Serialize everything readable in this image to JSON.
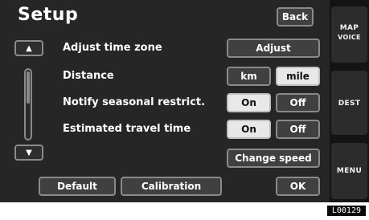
{
  "title": "Setup",
  "back_label": "Back",
  "rows": [
    {
      "label": "Adjust time zone",
      "button": "Adjust"
    },
    {
      "label": "Distance",
      "options": [
        "km",
        "mile"
      ],
      "selected": "mile"
    },
    {
      "label": "Notify seasonal restrict.",
      "options": [
        "On",
        "Off"
      ],
      "selected": "On"
    },
    {
      "label": "Estimated travel time",
      "options": [
        "On",
        "Off"
      ],
      "selected": "On"
    }
  ],
  "change_speed_label": "Change speed",
  "footer_buttons": {
    "default": "Default",
    "calibration": "Calibration",
    "ok": "OK"
  },
  "side_buttons": {
    "map_top": "MAP",
    "map_bottom": "VOICE",
    "dest": "DEST",
    "menu": "MENU"
  },
  "scroll": {
    "up": "▲",
    "down": "▼"
  },
  "reference_code": "L00129",
  "colors": {
    "screen_bg": "#262626",
    "button_border": "#8a8a8a",
    "selected_bg": "#e8e8e8"
  }
}
